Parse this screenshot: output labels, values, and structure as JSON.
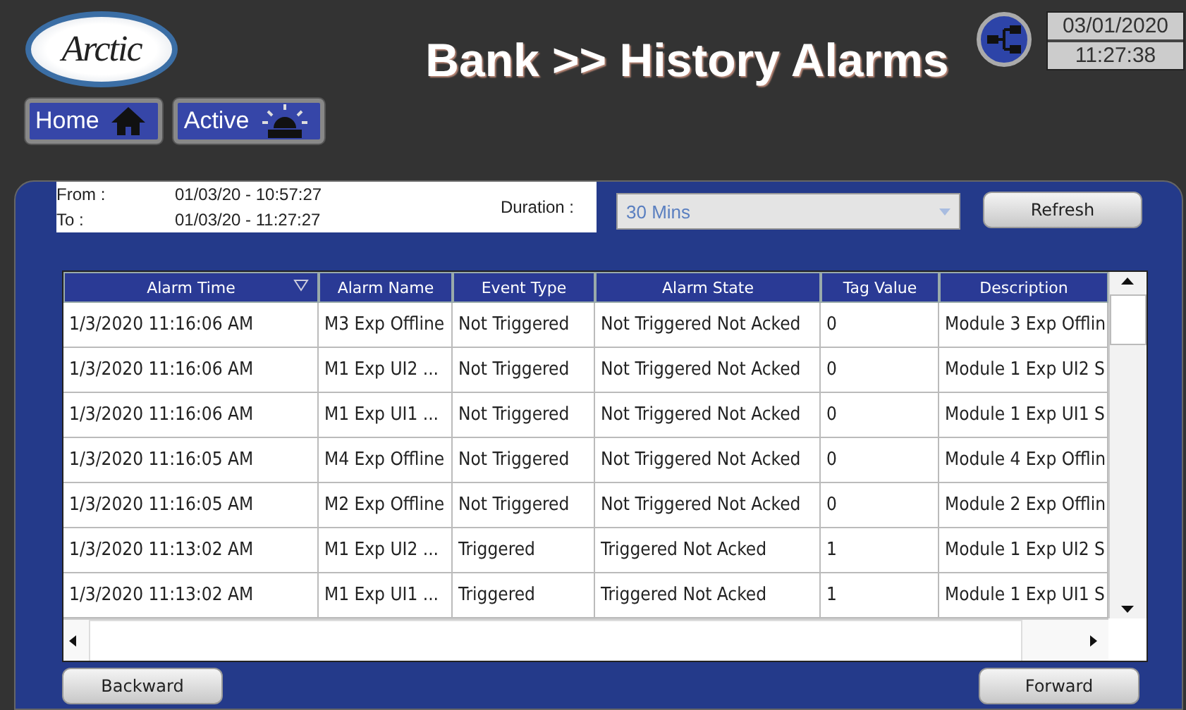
{
  "header": {
    "logo": "Arctic",
    "title": "Bank >> History Alarms",
    "date": "03/01/2020",
    "time": "11:27:38"
  },
  "nav": [
    {
      "label": "Home",
      "kind": "home"
    },
    {
      "label": "Active",
      "kind": "alarm"
    }
  ],
  "filter": {
    "from_label": "From :",
    "from_value": "01/03/20 - 10:57:27",
    "to_label": "To :",
    "to_value": "01/03/20 - 11:27:27",
    "duration_label": "Duration :",
    "duration_value": "30 Mins",
    "duration_disabled": true,
    "refresh": "Refresh"
  },
  "table": {
    "columns": [
      "Alarm Time",
      "Alarm Name",
      "Event Type",
      "Alarm State",
      "Tag Value",
      "Description"
    ],
    "rows": [
      [
        "1/3/2020 11:16:06 AM",
        "M3 Exp Offline",
        "Not Triggered",
        "Not Triggered Not Acked",
        "0",
        "Module 3 Exp Offlin"
      ],
      [
        "1/3/2020 11:16:06 AM",
        "M1 Exp UI2 ...",
        "Not Triggered",
        "Not Triggered Not Acked",
        "0",
        "Module 1 Exp UI2 S"
      ],
      [
        "1/3/2020 11:16:06 AM",
        "M1 Exp UI1 ...",
        "Not Triggered",
        "Not Triggered Not Acked",
        "0",
        "Module 1 Exp UI1 S"
      ],
      [
        "1/3/2020 11:16:05 AM",
        "M4 Exp Offline",
        "Not Triggered",
        "Not Triggered Not Acked",
        "0",
        "Module 4 Exp Offlin"
      ],
      [
        "1/3/2020 11:16:05 AM",
        "M2 Exp Offline",
        "Not Triggered",
        "Not Triggered Not Acked",
        "0",
        "Module 2 Exp Offlin"
      ],
      [
        "1/3/2020 11:13:02 AM",
        "M1 Exp UI2 ...",
        "Triggered",
        "Triggered Not Acked",
        "1",
        "Module 1 Exp UI2 S"
      ],
      [
        "1/3/2020 11:13:02 AM",
        "M1 Exp UI1 ...",
        "Triggered",
        "Triggered Not Acked",
        "1",
        "Module 1 Exp UI1 S"
      ]
    ]
  },
  "footer": {
    "backward": "Backward",
    "forward": "Forward"
  }
}
